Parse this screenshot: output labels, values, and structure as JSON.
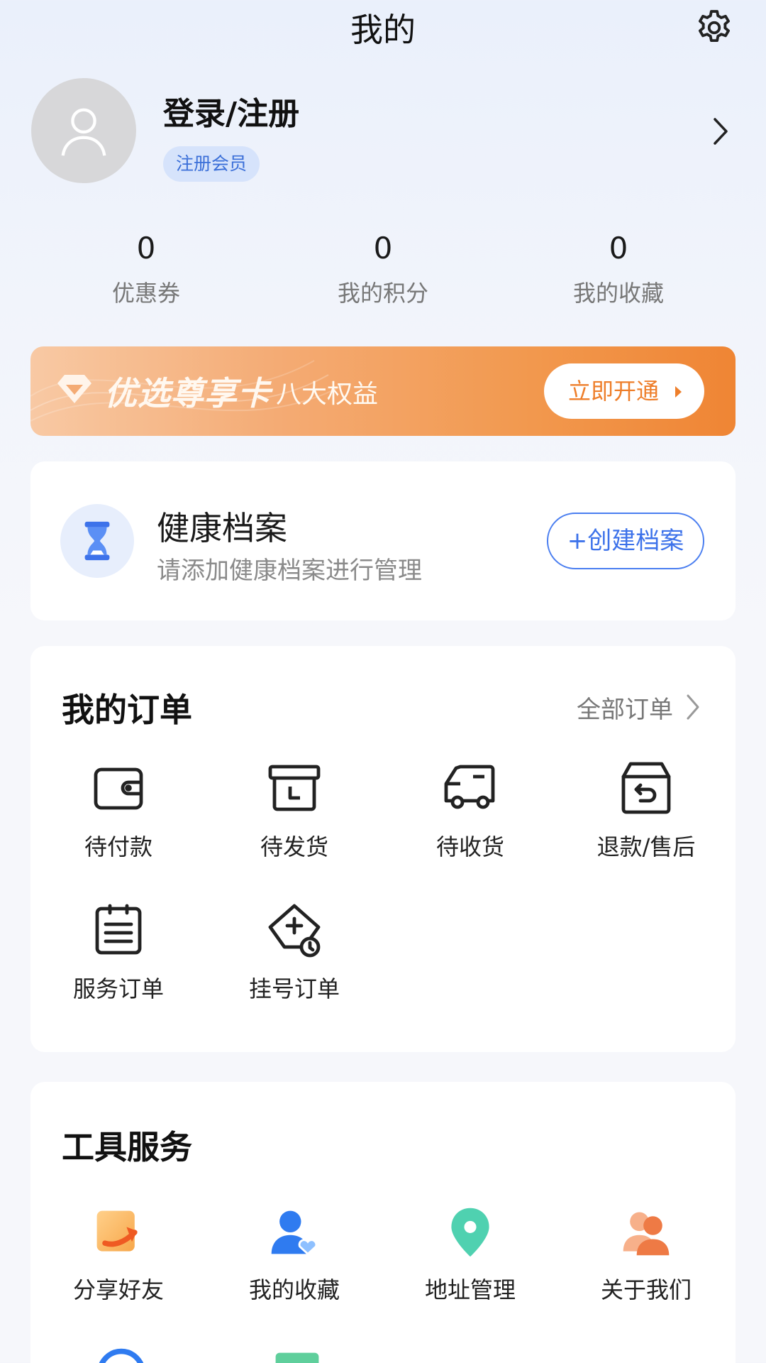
{
  "header": {
    "title": "我的",
    "settings_icon": "gear-icon"
  },
  "profile": {
    "login_text": "登录/注册",
    "member_tag": "注册会员"
  },
  "stats": [
    {
      "value": "0",
      "label": "优惠券"
    },
    {
      "value": "0",
      "label": "我的积分"
    },
    {
      "value": "0",
      "label": "我的收藏"
    }
  ],
  "vip": {
    "title": "优选尊享卡",
    "subtitle": "八大权益",
    "button": "立即开通"
  },
  "health": {
    "title": "健康档案",
    "subtitle": "请添加健康档案进行管理",
    "button": "+创建档案"
  },
  "orders": {
    "title": "我的订单",
    "all_label": "全部订单",
    "items": [
      {
        "label": "待付款",
        "icon": "wallet-icon"
      },
      {
        "label": "待发货",
        "icon": "package-clock-icon"
      },
      {
        "label": "待收货",
        "icon": "truck-icon"
      },
      {
        "label": "退款/售后",
        "icon": "return-box-icon"
      },
      {
        "label": "服务订单",
        "icon": "clipboard-list-icon"
      },
      {
        "label": "挂号订单",
        "icon": "medical-tag-icon"
      }
    ]
  },
  "tools": {
    "title": "工具服务",
    "items": [
      {
        "label": "分享好友",
        "icon": "share-icon"
      },
      {
        "label": "我的收藏",
        "icon": "favorite-user-icon"
      },
      {
        "label": "地址管理",
        "icon": "location-pin-icon"
      },
      {
        "label": "关于我们",
        "icon": "team-icon"
      }
    ]
  },
  "colors": {
    "accent_blue": "#3d72ea",
    "vip_orange": "#ef8534",
    "teal": "#4fd1b0"
  }
}
